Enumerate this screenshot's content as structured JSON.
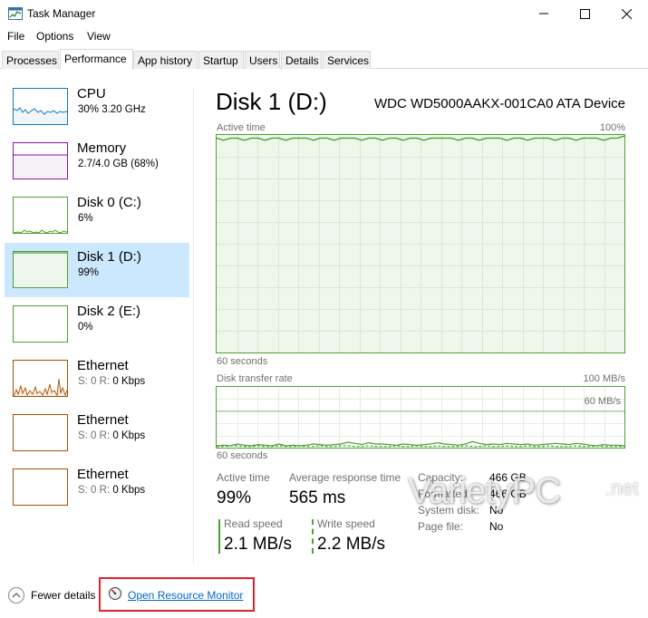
{
  "window": {
    "title": "Task Manager",
    "app_icon": "task-manager-icon"
  },
  "menu": [
    "File",
    "Options",
    "View"
  ],
  "tabs": [
    {
      "label": "Processes"
    },
    {
      "label": "Performance",
      "active": true
    },
    {
      "label": "App history"
    },
    {
      "label": "Startup"
    },
    {
      "label": "Users"
    },
    {
      "label": "Details"
    },
    {
      "label": "Services"
    }
  ],
  "sidebar": {
    "items": [
      {
        "name": "CPU",
        "sub_main": "30%  3.20 GHz",
        "sub_dim": "",
        "color": "#1079bf"
      },
      {
        "name": "Memory",
        "sub_main": "2.7/4.0 GB (68%)",
        "sub_dim": "",
        "color": "#8b12ae"
      },
      {
        "name": "Disk 0 (C:)",
        "sub_main": "6%",
        "sub_dim": "",
        "color": "#4da033"
      },
      {
        "name": "Disk 1 (D:)",
        "sub_main": "99%",
        "sub_dim": "",
        "color": "#4da033",
        "selected": true
      },
      {
        "name": "Disk 2 (E:)",
        "sub_main": "0%",
        "sub_dim": "",
        "color": "#4da033"
      },
      {
        "name": "Ethernet",
        "sub_dim": "S: 0 R: ",
        "sub_main": "0 Kbps",
        "color": "#a74f01"
      },
      {
        "name": "Ethernet",
        "sub_dim": "S: 0 R: ",
        "sub_main": "0 Kbps",
        "color": "#a74f01"
      },
      {
        "name": "Ethernet",
        "sub_dim": "S: 0 R: ",
        "sub_main": "0 Kbps",
        "color": "#a74f01"
      }
    ]
  },
  "main": {
    "title": "Disk 1 (D:)",
    "device": "WDC WD5000AAKX-001CA0 ATA Device",
    "active_time_graph": {
      "label": "Active time",
      "max_label": "100%",
      "time_label": "60 seconds"
    },
    "transfer_graph": {
      "label": "Disk transfer rate",
      "max_label": "100 MB/s",
      "mid_label": "60 MB/s",
      "time_label": "60 seconds"
    },
    "stats": {
      "active_time_label": "Active time",
      "active_time_value": "99%",
      "avg_response_label": "Average response time",
      "avg_response_value": "565 ms",
      "read_speed_label": "Read speed",
      "read_speed_value": "2.1 MB/s",
      "write_speed_label": "Write speed",
      "write_speed_value": "2.2 MB/s"
    },
    "properties": [
      {
        "label": "Capacity:",
        "value": "466 GB"
      },
      {
        "label": "Formatted:",
        "value": "466 GB"
      },
      {
        "label": "System disk:",
        "value": "No"
      },
      {
        "label": "Page file:",
        "value": "No"
      }
    ]
  },
  "watermark": {
    "text_variety": "Variety",
    "text_pc": "PC",
    "text_net": ".net"
  },
  "footer": {
    "fewer_details": "Fewer details",
    "open_resource_monitor": "Open Resource Monitor"
  },
  "chart_data": [
    {
      "type": "area",
      "title": "Active time",
      "ylim": [
        0,
        100
      ],
      "x_span_label": "60 seconds",
      "series": [
        {
          "values": [
            99,
            98,
            99,
            99,
            98,
            99,
            99,
            98,
            99,
            99,
            98,
            99,
            99,
            99,
            98,
            99,
            99,
            98,
            99,
            99,
            99,
            98,
            99,
            99,
            98,
            99,
            99,
            98,
            99,
            99,
            98,
            99,
            99,
            99,
            99,
            98,
            99,
            99,
            98,
            99,
            99,
            99,
            98,
            99,
            99,
            98,
            99,
            99,
            99,
            98,
            99,
            99,
            98,
            99,
            99,
            99,
            98,
            99,
            99,
            100
          ]
        }
      ],
      "grid": true,
      "color": "#4da033"
    },
    {
      "type": "line",
      "title": "Disk transfer rate",
      "ylim": [
        0,
        100
      ],
      "ylabel_ticks": [
        "100 MB/s",
        "60 MB/s"
      ],
      "x_span_label": "60 seconds",
      "series": [
        {
          "values": [
            3,
            4,
            3,
            6,
            4,
            3,
            5,
            4,
            3,
            6,
            3,
            4,
            3,
            4,
            6,
            5,
            4,
            5,
            6,
            9,
            7,
            5,
            8,
            6,
            6,
            5,
            4,
            6,
            5,
            4,
            5,
            6,
            8,
            6,
            5,
            4,
            6,
            10,
            7,
            5,
            6,
            5,
            7,
            6,
            5,
            6,
            4,
            5,
            6,
            7,
            6,
            5,
            7,
            6,
            4,
            3,
            5,
            4,
            4,
            3
          ]
        },
        {
          "values": [
            2,
            2,
            3,
            3,
            2,
            2,
            3,
            2,
            2,
            3,
            2,
            2,
            3,
            2,
            2,
            3,
            2,
            2,
            3,
            3,
            2,
            2,
            3,
            2,
            2,
            2,
            3,
            2,
            2,
            3,
            2,
            2,
            3,
            2,
            2,
            2,
            3,
            2,
            2,
            3,
            2,
            2,
            3,
            2,
            2,
            3,
            2,
            2,
            3,
            2,
            2,
            2,
            3,
            2,
            2,
            3,
            2,
            2,
            2,
            2
          ]
        }
      ],
      "grid": true,
      "color": "#4da033"
    }
  ]
}
